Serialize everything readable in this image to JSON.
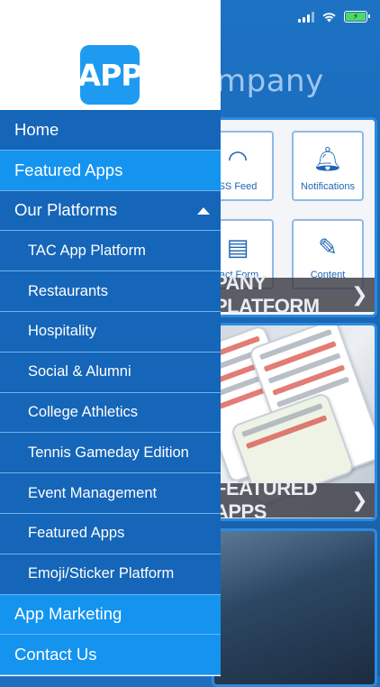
{
  "background": {
    "title_fragment": "mpany",
    "panel1": {
      "tiles": [
        {
          "label": "SS Feed",
          "icon": "rss-icon"
        },
        {
          "label": "Notifications",
          "icon": "bell-icon"
        },
        {
          "label": "tact Form",
          "icon": "form-icon"
        },
        {
          "label": "Content",
          "icon": "edit-icon"
        }
      ],
      "banner": "PANY PLATFORM"
    },
    "panel2": {
      "banner": "FEATURED APPS"
    }
  },
  "drawer": {
    "logo_text": "APP",
    "menu": {
      "home": "Home",
      "featured_apps": "Featured Apps",
      "our_platforms": "Our Platforms",
      "sub": [
        "TAC App Platform",
        "Restaurants",
        "Hospitality",
        "Social & Alumni",
        "College Athletics",
        "Tennis Gameday Edition",
        "Event Management",
        "Featured Apps",
        "Emoji/Sticker Platform"
      ],
      "app_marketing": "App Marketing",
      "contact_us": "Contact Us"
    }
  },
  "colors": {
    "drawer_dark": "#1565b8",
    "drawer_bright": "#1494ef",
    "logo": "#1e9bf0",
    "battery": "#4cd964"
  }
}
